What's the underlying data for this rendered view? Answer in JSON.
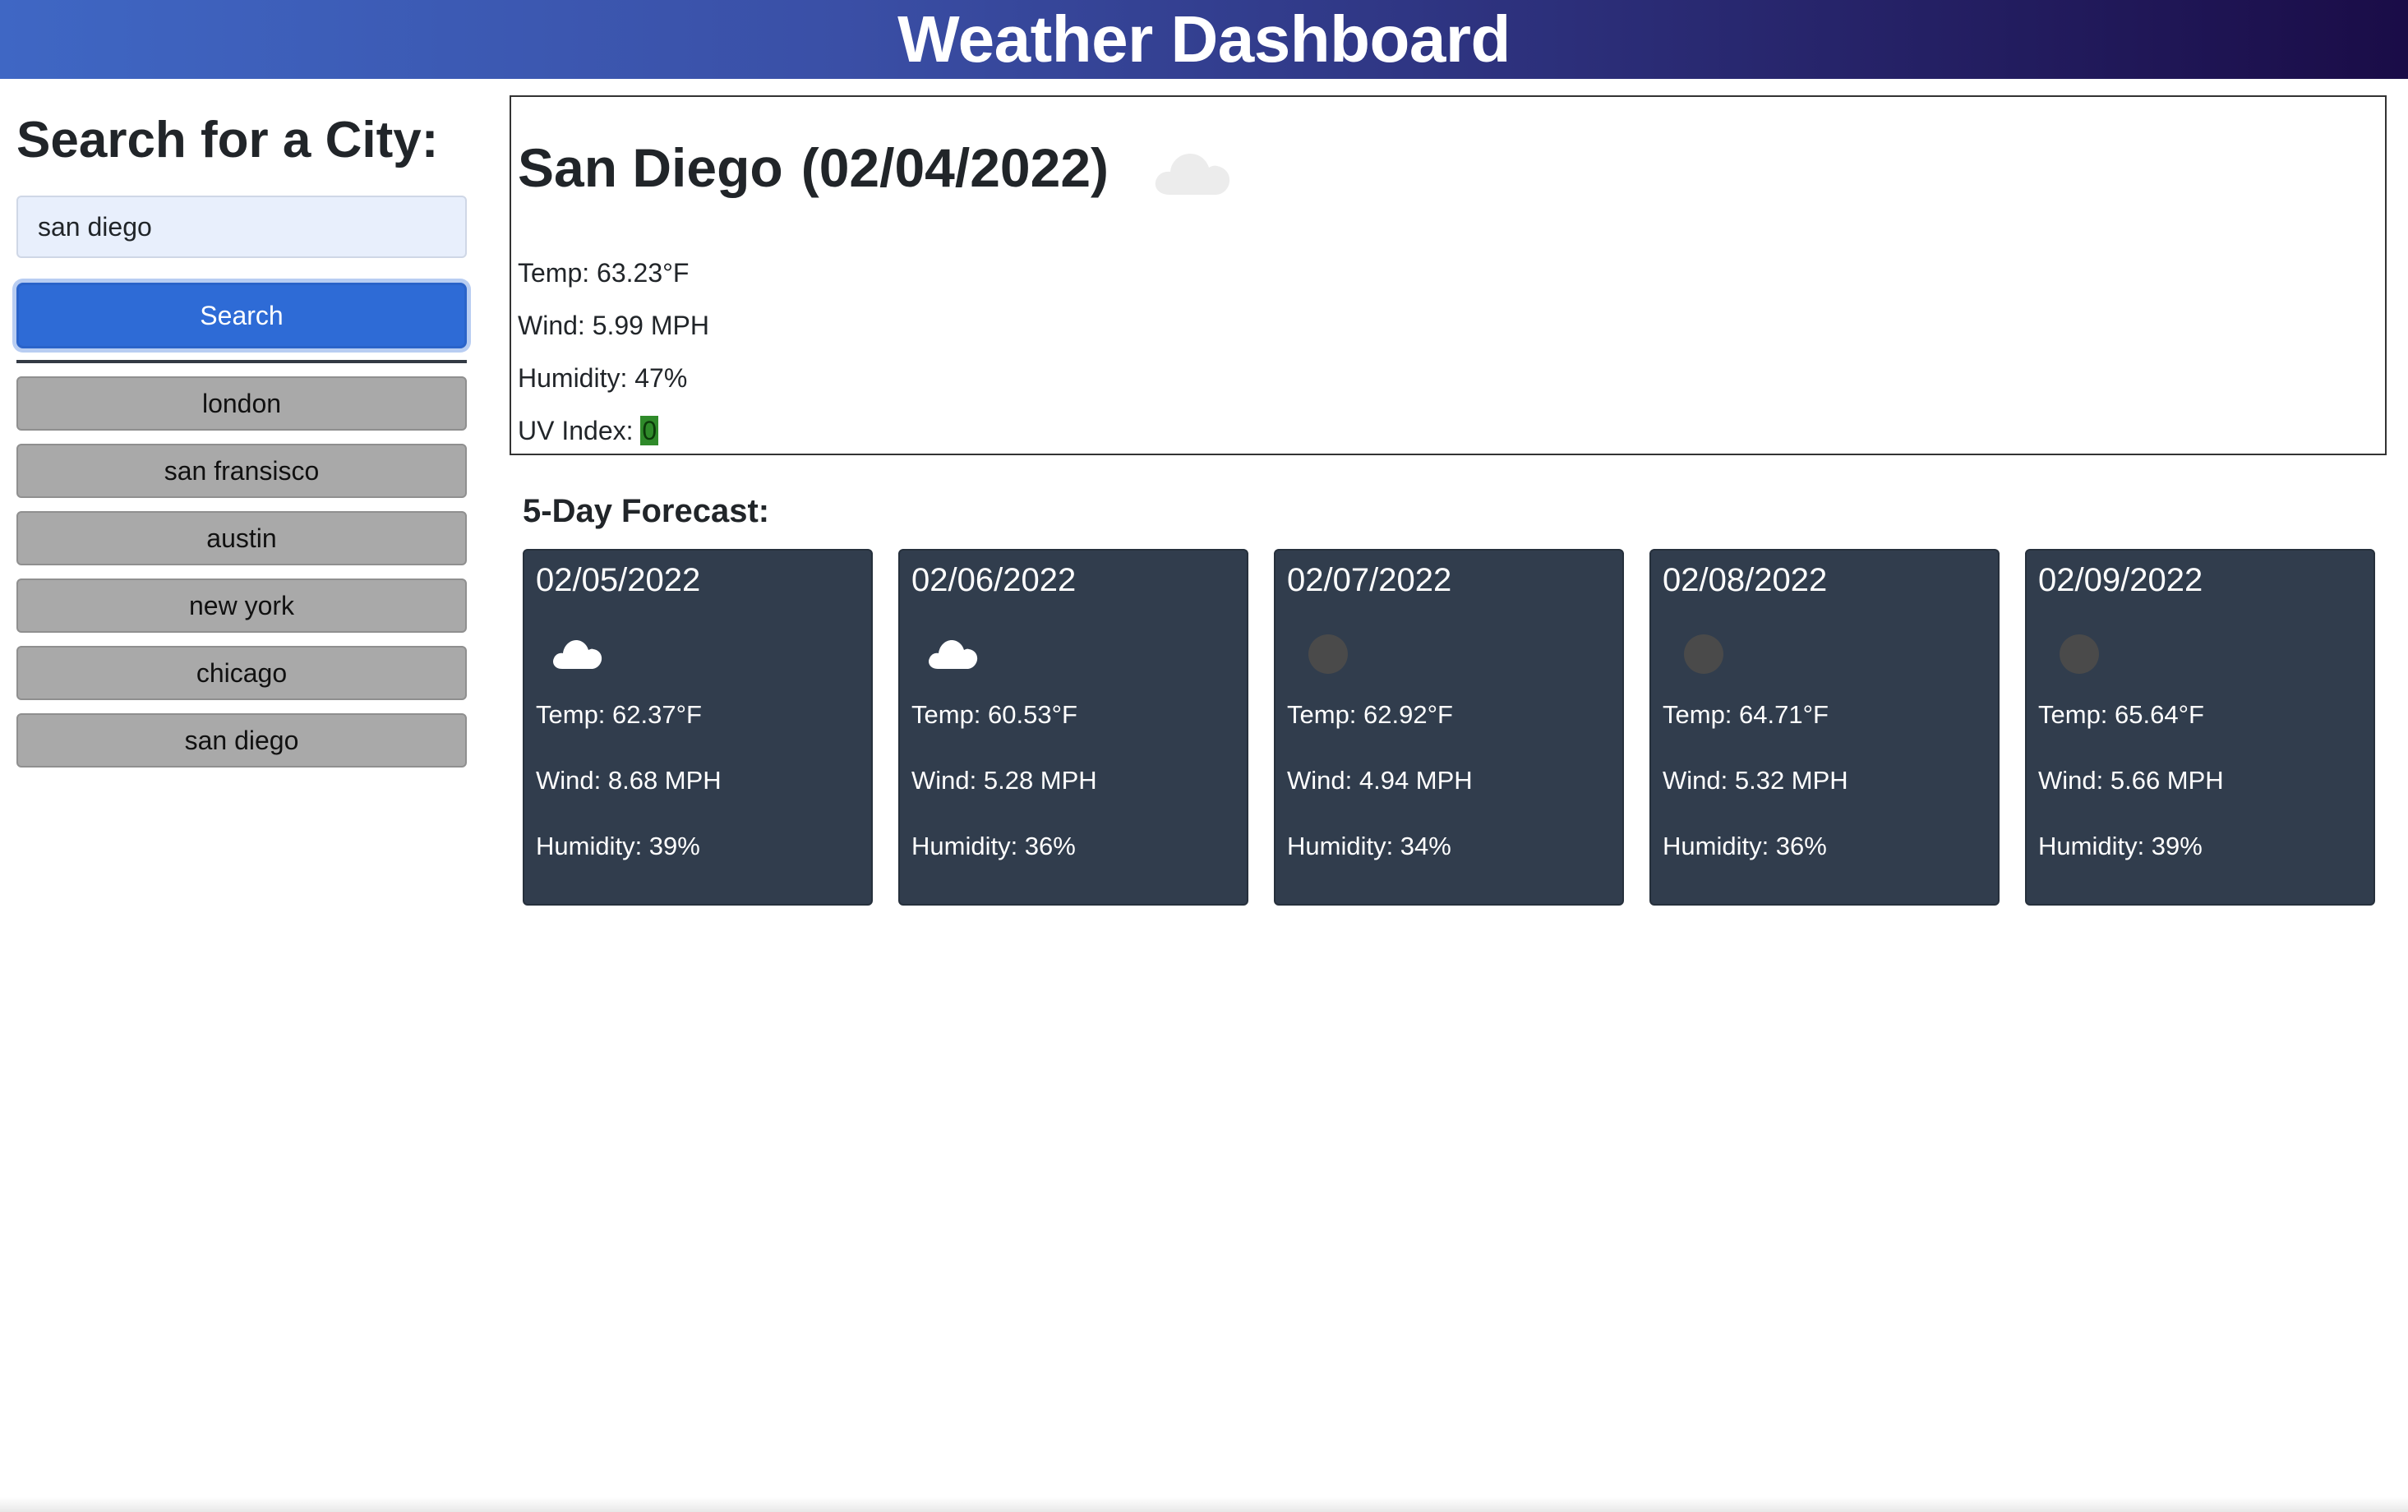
{
  "header": {
    "title": "Weather Dashboard"
  },
  "sidebar": {
    "heading": "Search for a City:",
    "search_value": "san diego",
    "search_button": "Search",
    "history": [
      "london",
      "san fransisco",
      "austin",
      "new york",
      "chicago",
      "san diego"
    ]
  },
  "current": {
    "city": "San Diego",
    "date": "(02/04/2022)",
    "icon": "cloud-icon",
    "temp": "Temp: 63.23°F",
    "wind": "Wind: 5.99 MPH",
    "humidity": "Humidity: 47%",
    "uv_label": "UV Index:",
    "uv_value": "0",
    "uv_color": "#2f8a2a"
  },
  "forecast": {
    "heading": "5-Day Forecast:",
    "days": [
      {
        "date": "02/05/2022",
        "icon": "cloud-icon",
        "temp": "Temp: 62.37°F",
        "wind": "Wind: 8.68 MPH",
        "humidity": "Humidity: 39%"
      },
      {
        "date": "02/06/2022",
        "icon": "cloud-icon",
        "temp": "Temp: 60.53°F",
        "wind": "Wind: 5.28 MPH",
        "humidity": "Humidity: 36%"
      },
      {
        "date": "02/07/2022",
        "icon": "dark-dot-icon",
        "temp": "Temp: 62.92°F",
        "wind": "Wind: 4.94 MPH",
        "humidity": "Humidity: 34%"
      },
      {
        "date": "02/08/2022",
        "icon": "dark-dot-icon",
        "temp": "Temp: 64.71°F",
        "wind": "Wind: 5.32 MPH",
        "humidity": "Humidity: 36%"
      },
      {
        "date": "02/09/2022",
        "icon": "dark-dot-icon",
        "temp": "Temp: 65.64°F",
        "wind": "Wind: 5.66 MPH",
        "humidity": "Humidity: 39%"
      }
    ]
  },
  "colors": {
    "header_start": "#3f67c4",
    "header_end": "#1a0c47",
    "search_button": "#2e6bd6",
    "history_button": "#a9a9a9",
    "forecast_card": "#313d4d"
  }
}
